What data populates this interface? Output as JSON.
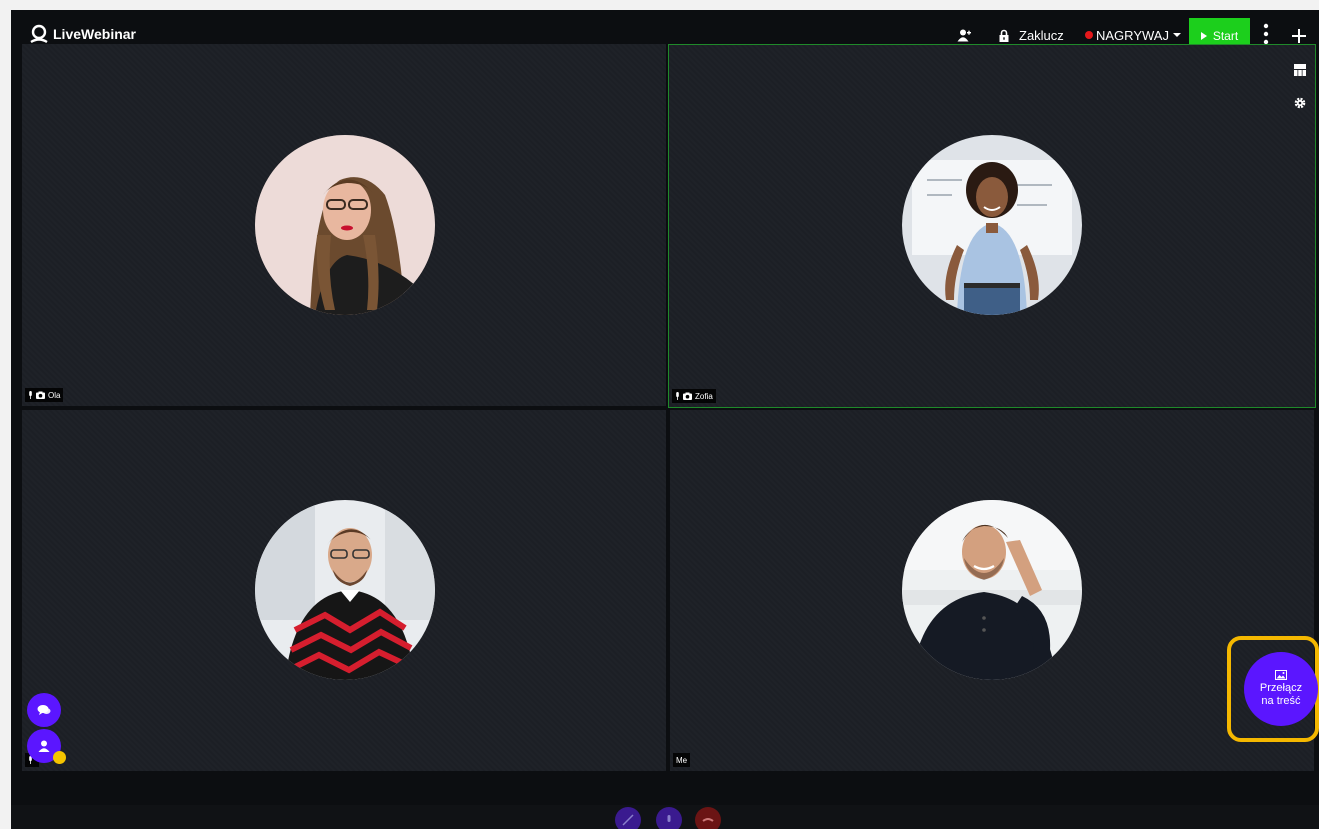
{
  "app": {
    "logo_text": "LiveWebinar"
  },
  "topbar": {
    "lock_label": "Zaklucz",
    "record_label": "NAGRYWAJ",
    "start_label": "Start"
  },
  "participants": [
    {
      "name": "Ola"
    },
    {
      "name": "Zofia"
    },
    {
      "name": ""
    },
    {
      "name": "Me"
    }
  ],
  "switch_button": {
    "line1": "Przełącz",
    "line2": "na treść"
  },
  "colors": {
    "accent_purple": "#5b16ff",
    "start_green": "#1ccf1c",
    "record_red": "#e5181b",
    "highlight_yellow": "#f5b800"
  }
}
